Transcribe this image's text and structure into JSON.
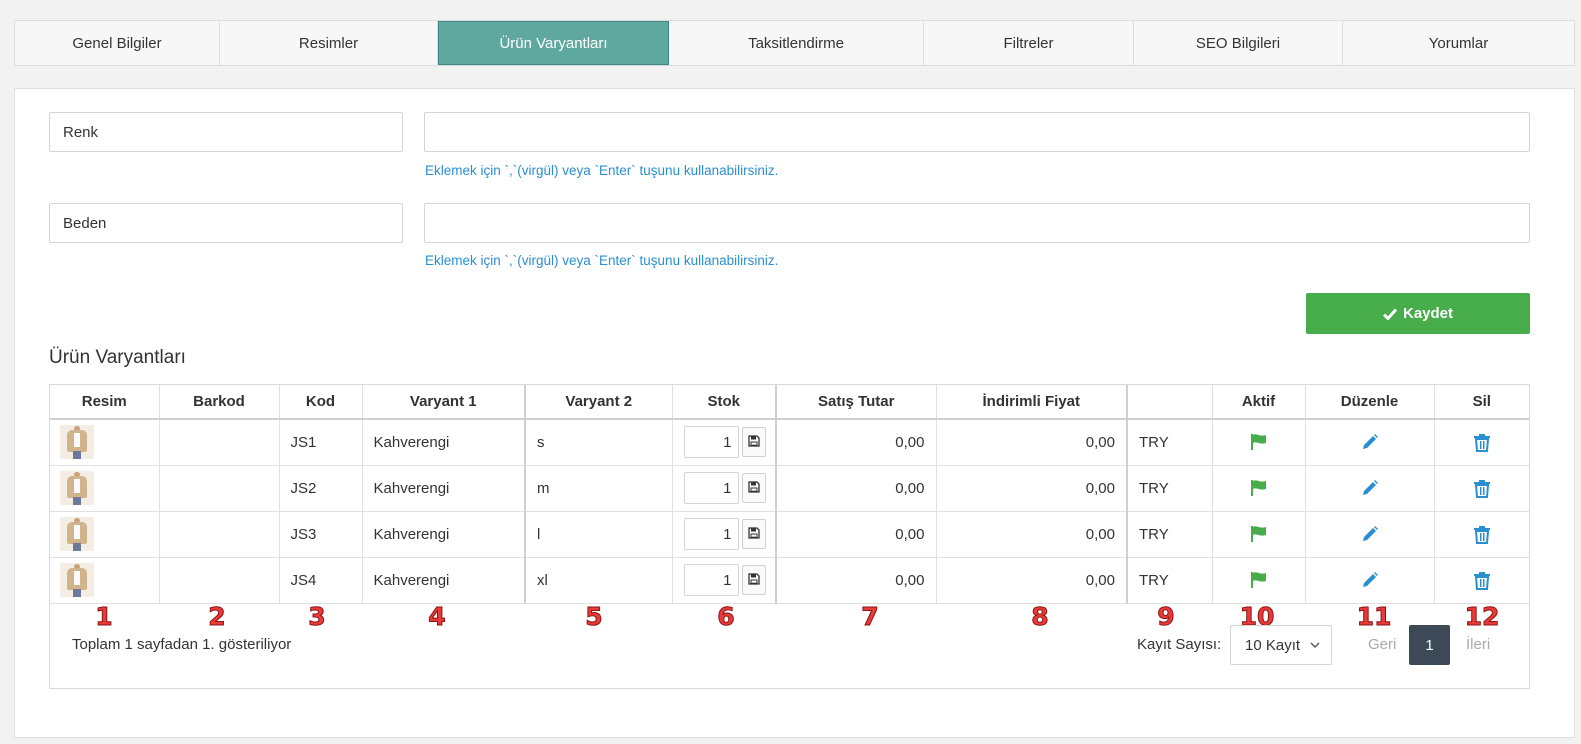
{
  "tabs": [
    {
      "label": "Genel Bilgiler",
      "active": false
    },
    {
      "label": "Resimler",
      "active": false
    },
    {
      "label": "Ürün Varyantları",
      "active": true
    },
    {
      "label": "Taksitlendirme",
      "active": false
    },
    {
      "label": "Filtreler",
      "active": false
    },
    {
      "label": "SEO Bilgileri",
      "active": false
    },
    {
      "label": "Yorumlar",
      "active": false
    }
  ],
  "attributes": [
    {
      "name": "Renk",
      "value": "",
      "hint": "Eklemek için `,`(virgül) veya `Enter` tuşunu kullanabilirsiniz."
    },
    {
      "name": "Beden",
      "value": "",
      "hint": "Eklemek için `,`(virgül) veya `Enter` tuşunu kullanabilirsiniz."
    }
  ],
  "save_button": {
    "label": "Kaydet",
    "icon": "check-icon",
    "color": "#46ad4a"
  },
  "section_title": "Ürün Varyantları",
  "table": {
    "headers": [
      "Resim",
      "Barkod",
      "Kod",
      "Varyant 1",
      "Varyant 2",
      "Stok",
      "Satış Tutar",
      "İndirimli Fiyat",
      "",
      "Aktif",
      "Düzenle",
      "Sil"
    ],
    "rows": [
      {
        "image": "product-thumbnail",
        "barcode": "",
        "code": "JS1",
        "variant1": "Kahverengi",
        "variant2": "s",
        "stock": "1",
        "price": "0,00",
        "discount_price": "0,00",
        "currency": "TRY"
      },
      {
        "image": "product-thumbnail",
        "barcode": "",
        "code": "JS2",
        "variant1": "Kahverengi",
        "variant2": "m",
        "stock": "1",
        "price": "0,00",
        "discount_price": "0,00",
        "currency": "TRY"
      },
      {
        "image": "product-thumbnail",
        "barcode": "",
        "code": "JS3",
        "variant1": "Kahverengi",
        "variant2": "l",
        "stock": "1",
        "price": "0,00",
        "discount_price": "0,00",
        "currency": "TRY"
      },
      {
        "image": "product-thumbnail",
        "barcode": "",
        "code": "JS4",
        "variant1": "Kahverengi",
        "variant2": "xl",
        "stock": "1",
        "price": "0,00",
        "discount_price": "0,00",
        "currency": "TRY"
      }
    ]
  },
  "column_numbers": [
    "1",
    "2",
    "3",
    "4",
    "5",
    "6",
    "7",
    "8",
    "9",
    "10",
    "11",
    "12"
  ],
  "footer": {
    "summary": "Toplam 1 sayfadan 1. gösteriliyor",
    "record_label": "Kayıt Sayısı:",
    "record_select": "10 Kayıt",
    "prev": "Geri",
    "page": "1",
    "next": "İleri"
  },
  "colors": {
    "accent_tab": "#5fa8a0",
    "hint": "#2a8fd1",
    "flag": "#46ad4a",
    "action_icon": "#2a8fd1",
    "annotation": "#e93a3a"
  }
}
